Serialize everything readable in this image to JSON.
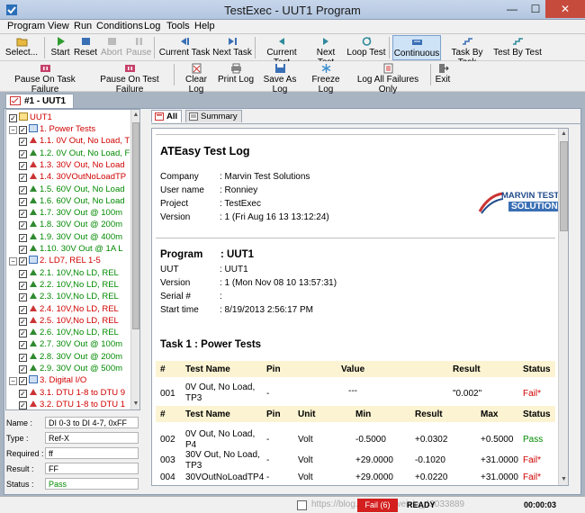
{
  "window": {
    "title": "TestExec - UUT1 Program",
    "minimize": "—",
    "maximize": "☐",
    "close": "✕"
  },
  "menu": [
    "Program",
    "View",
    "Run",
    "Conditions",
    "Log",
    "Tools",
    "Help"
  ],
  "toolbar1": {
    "select": "Select...",
    "start": "Start",
    "reset": "Reset",
    "abort": "Abort",
    "pause": "Pause",
    "current_task": "Current Task",
    "next_task": "Next Task",
    "current_test": "Current Test",
    "next_test": "Next Test",
    "loop_test": "Loop Test",
    "continuous": "Continuous",
    "task_by_task": "Task By Task",
    "test_by_test": "Test By Test"
  },
  "toolbar2": {
    "pause_task_failure": "Pause On Task Failure",
    "pause_test_failure": "Pause On Test Failure",
    "clear_log": "Clear Log",
    "print_log": "Print Log",
    "save_as_log": "Save As Log",
    "freeze_log": "Freeze Log",
    "log_all_failures": "Log All Failures Only",
    "exit": "Exit"
  },
  "doc_tab": "#1 - UUT1",
  "tree": {
    "root": "UUT1",
    "items": [
      {
        "label": "1. Power Tests",
        "color": "red",
        "level": 1
      },
      {
        "label": "1.1. 0V Out, No Load, T",
        "color": "red",
        "level": 2
      },
      {
        "label": "1.2. 0V Out, No Load, F",
        "color": "green",
        "level": 2
      },
      {
        "label": "1.3. 30V Out, No Load",
        "color": "red",
        "level": 2
      },
      {
        "label": "1.4. 30VOutNoLoadTP",
        "color": "red",
        "level": 2
      },
      {
        "label": "1.5. 60V Out, No Load",
        "color": "green",
        "level": 2
      },
      {
        "label": "1.6. 60V Out, No Load",
        "color": "green",
        "level": 2
      },
      {
        "label": "1.7. 30V Out @ 100m",
        "color": "green",
        "level": 2
      },
      {
        "label": "1.8. 30V Out @ 200m",
        "color": "green",
        "level": 2
      },
      {
        "label": "1.9. 30V Out @ 400m",
        "color": "green",
        "level": 2
      },
      {
        "label": "1.10. 30V Out @ 1A L",
        "color": "green",
        "level": 2
      },
      {
        "label": "2. LD7, REL 1-5",
        "color": "red",
        "level": 1
      },
      {
        "label": "2.1. 10V,No LD, REL",
        "color": "green",
        "level": 2
      },
      {
        "label": "2.2. 10V,No LD, REL",
        "color": "green",
        "level": 2
      },
      {
        "label": "2.3. 10V,No LD, REL",
        "color": "green",
        "level": 2
      },
      {
        "label": "2.4. 10V,No LD, REL",
        "color": "red",
        "level": 2
      },
      {
        "label": "2.5. 10V,No LD, REL",
        "color": "red",
        "level": 2
      },
      {
        "label": "2.6. 10V,No LD, REL",
        "color": "green",
        "level": 2
      },
      {
        "label": "2.7. 30V Out @ 100m",
        "color": "green",
        "level": 2
      },
      {
        "label": "2.8. 30V Out @ 200m",
        "color": "green",
        "level": 2
      },
      {
        "label": "2.9. 30V Out @ 500m",
        "color": "green",
        "level": 2
      },
      {
        "label": "3. Digital I/O",
        "color": "red",
        "level": 1
      },
      {
        "label": "3.1. DTU 1-8 to DTU 9",
        "color": "red",
        "level": 2
      },
      {
        "label": "3.2. DTU 1-8 to DTU 1",
        "color": "red",
        "level": 2
      }
    ]
  },
  "props": [
    {
      "label": "Name :",
      "value": "DI 0-3 to DI 4-7, 0xFF"
    },
    {
      "label": "Type :",
      "value": "Ref-X"
    },
    {
      "label": "Required :",
      "value": "ff"
    },
    {
      "label": "Result :",
      "value": "FF"
    },
    {
      "label": "Status :",
      "value": "Pass"
    }
  ],
  "log_tabs": {
    "all": "All",
    "summary": "Summary"
  },
  "log": {
    "title": "ATEasy Test Log",
    "info": [
      {
        "k": "Company",
        "v": ": Marvin Test Solutions"
      },
      {
        "k": "User name",
        "v": ": Ronniey"
      },
      {
        "k": "Project",
        "v": ": TestExec"
      },
      {
        "k": "Version",
        "v": ": 1 (Fri Aug 16 13 13:12:24)"
      }
    ],
    "logo": {
      "line1": "MARVIN TEST",
      "line2": "SOLUTIONS"
    },
    "program_label": "Program",
    "program_value": ": UUT1",
    "program": [
      {
        "k": "UUT",
        "v": ": UUT1"
      },
      {
        "k": "Version",
        "v": ": 1 (Mon Nov 08 10 13:57:31)"
      },
      {
        "k": "Serial #",
        "v": ":"
      },
      {
        "k": "Start time",
        "v": ": 8/19/2013 2:56:17 PM"
      }
    ],
    "task_title": "Task 1 : Power Tests",
    "header1": {
      "num": "#",
      "name": "Test Name",
      "pin": "Pin",
      "value": "Value",
      "result": "Result",
      "status": "Status"
    },
    "row1": {
      "num": "001",
      "name": "0V Out, No Load, TP3",
      "pin": "-",
      "value": "---",
      "result": "\"0.002\"",
      "status": "Fail*"
    },
    "header2": {
      "num": "#",
      "name": "Test Name",
      "pin": "Pin",
      "unit": "Unit",
      "min": "Min",
      "result": "Result",
      "max": "Max",
      "status": "Status"
    },
    "rows": [
      {
        "num": "002",
        "name": "0V Out, No Load, P4",
        "pin": "-",
        "unit": "Volt",
        "min": "-0.5000",
        "result": "+0.0302",
        "max": "+0.5000",
        "status": "Pass",
        "state": "pass"
      },
      {
        "num": "003",
        "name": "30V Out, No Load, TP3",
        "pin": "-",
        "unit": "Volt",
        "min": "+29.0000",
        "result": "-0.1020",
        "max": "+31.0000",
        "status": "Fail*",
        "state": "fail"
      },
      {
        "num": "004",
        "name": "30VOutNoLoadTP4",
        "pin": "-",
        "unit": "Volt",
        "min": "+29.0000",
        "result": "+0.0220",
        "max": "+31.0000",
        "status": "Fail*",
        "state": "fail"
      }
    ]
  },
  "status": {
    "fail": "Fail (6)",
    "ready": "READY",
    "timer": "00:00:03"
  },
  "colors": {
    "fail_red": "#d00000",
    "pass_green": "#008a00",
    "header_band": "#fbf3d2",
    "logo_blue": "#214b8c"
  }
}
